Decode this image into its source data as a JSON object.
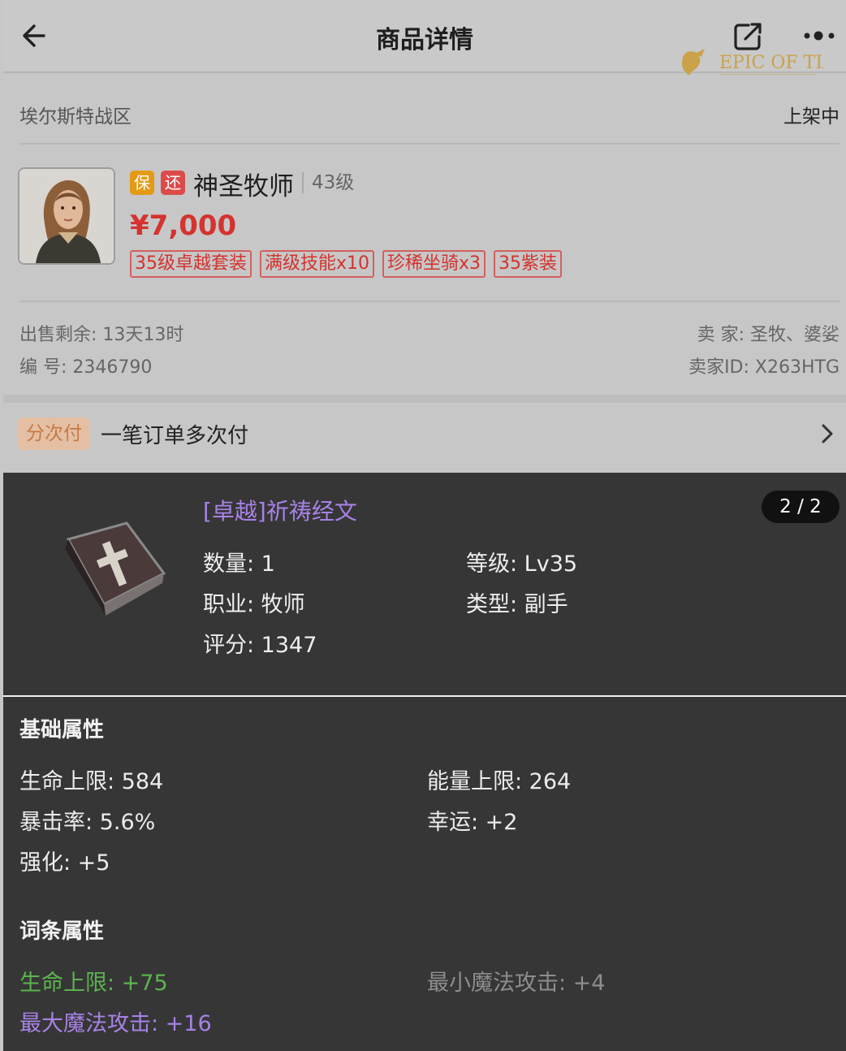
{
  "header": {
    "title": "商品详情",
    "logo_text": "EPIC OF TIA"
  },
  "listing": {
    "server": "埃尔斯特战区",
    "status": "上架中",
    "badges": [
      "保",
      "还"
    ],
    "role": "神圣牧师",
    "level": "43级",
    "price": "¥7,000",
    "tags": [
      "35级卓越套装",
      "满级技能x10",
      "珍稀坐骑x3",
      "35紫装"
    ],
    "time_left": "出售剩余: 13天13时",
    "number": "编 号: 2346790",
    "seller": "卖 家: 圣牧、婆娑",
    "seller_id": "卖家ID: X263HTG"
  },
  "installment": {
    "badge": "分次付",
    "text": "一笔订单多次付"
  },
  "item": {
    "name": "[卓越]祈祷经文",
    "pager": "2 / 2",
    "quantity": "数量: 1",
    "level": "等级: Lv35",
    "job": "职业: 牧师",
    "type": "类型: 副手",
    "score": "评分: 1347"
  },
  "base_attrs": {
    "title": "基础属性",
    "hp": "生命上限: 584",
    "energy": "能量上限: 264",
    "crit": "暴击率: 5.6%",
    "luck": "幸运: +2",
    "enhance": "强化: +5"
  },
  "affix_attrs": {
    "title": "词条属性",
    "hp": "生命上限: +75",
    "min_magic": "最小魔法攻击: +4",
    "max_magic": "最大魔法攻击: +16"
  },
  "colors": {
    "price_red": "#d4332f",
    "purple": "#a782e6",
    "green": "#5cb34f",
    "dark_panel": "#363636"
  }
}
